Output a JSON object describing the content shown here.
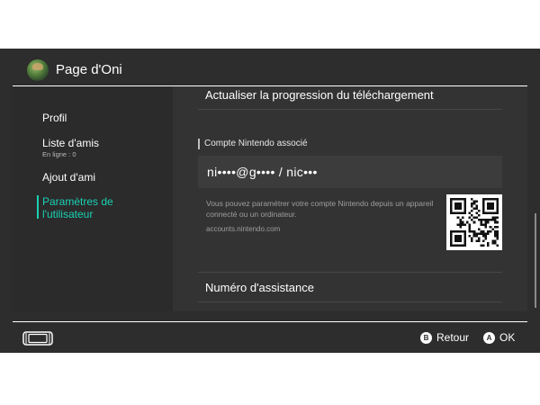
{
  "header": {
    "title": "Page d'Oni",
    "avatar_icon": "user-avatar"
  },
  "sidebar": {
    "items": [
      {
        "label": "Profil"
      },
      {
        "label": "Liste d'amis",
        "sublabel": "En ligne : 0"
      },
      {
        "label": "Ajout d'ami"
      },
      {
        "label": "Paramètres de l'utilisateur",
        "active": true
      }
    ]
  },
  "main": {
    "progress_row": "Actualiser la progression du téléchargement",
    "section_title": "Compte Nintendo associé",
    "account_value": "ni••••@g•••• / nic•••",
    "info_text": "Vous pouvez paramétrer votre compte Nintendo depuis un appareil connecté ou un ordinateur.",
    "info_url": "accounts.nintendo.com",
    "support_row": "Numéro d'assistance",
    "qr_icon": "qr-code"
  },
  "footer": {
    "console_icon": "switch-console-icon",
    "back_button_glyph": "B",
    "back_label": "Retour",
    "ok_button_glyph": "A",
    "ok_label": "OK"
  },
  "colors": {
    "accent": "#19d2b4",
    "background": "#2d2d2d",
    "panel": "#333333",
    "text": "#ffffff"
  }
}
